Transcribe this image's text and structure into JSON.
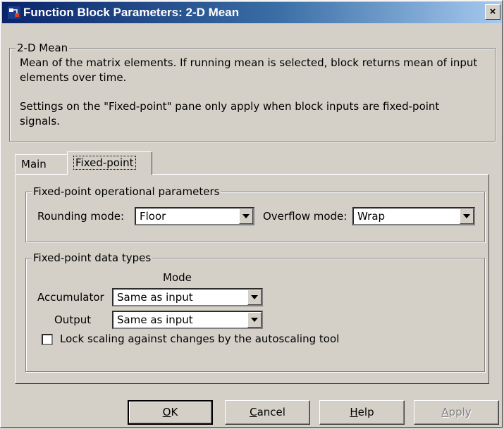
{
  "window": {
    "title": "Function Block Parameters: 2-D Mean",
    "close_label": "×"
  },
  "description_group": {
    "legend": "2-D Mean",
    "line1": "Mean of the matrix elements. If running mean is selected, block returns mean of input",
    "line2": "elements over time.",
    "line3": "Settings on the \"Fixed-point\" pane only apply when block inputs are fixed-point",
    "line4": "signals."
  },
  "tabs": [
    {
      "label": "Main",
      "active": false
    },
    {
      "label": "Fixed-point",
      "active": true
    }
  ],
  "operational_params": {
    "legend": "Fixed-point operational parameters",
    "rounding_label": "Rounding mode:",
    "rounding_value": "Floor",
    "overflow_label": "Overflow mode:",
    "overflow_value": "Wrap"
  },
  "data_types": {
    "legend": "Fixed-point data types",
    "mode_header": "Mode",
    "accumulator_label": "Accumulator",
    "accumulator_value": "Same as input",
    "output_label": "Output",
    "output_value": "Same as input",
    "lock_scaling_label": "Lock scaling against changes by the autoscaling tool",
    "lock_scaling_checked": false
  },
  "buttons": {
    "ok": {
      "mnemonic": "O",
      "rest": "K"
    },
    "cancel": {
      "mnemonic": "C",
      "rest": "ancel"
    },
    "help": {
      "mnemonic": "H",
      "rest": "elp"
    },
    "apply": {
      "mnemonic": "A",
      "rest": "pply",
      "enabled": false
    }
  },
  "colors": {
    "face": "#d4d0c8",
    "title_start": "#0a246a",
    "title_end": "#a6caf0"
  }
}
